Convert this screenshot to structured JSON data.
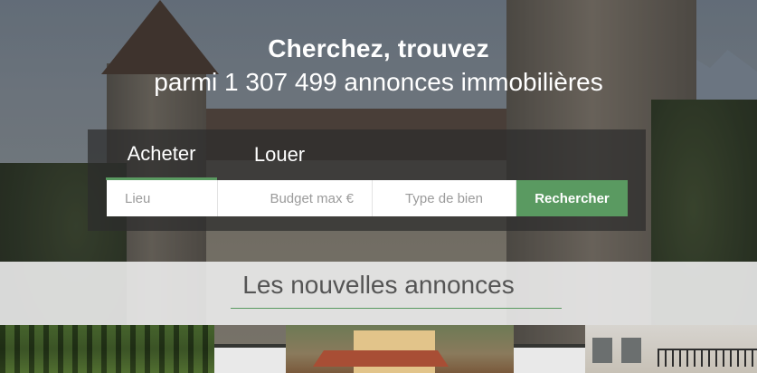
{
  "hero": {
    "headline_line1": "Cherchez, trouvez",
    "headline_line2": "parmi 1 307 499 annonces immobilières"
  },
  "search": {
    "tabs": [
      {
        "label": "Acheter",
        "active": true
      },
      {
        "label": "Louer",
        "active": false
      }
    ],
    "fields": {
      "location_placeholder": "Lieu",
      "budget_placeholder": "Budget max €",
      "type_placeholder": "Type de bien"
    },
    "submit_label": "Rechercher"
  },
  "listings": {
    "title": "Les nouvelles annonces"
  },
  "colors": {
    "accent": "#5a9a61",
    "panel": "#2d2d2d",
    "band": "#ececec"
  }
}
